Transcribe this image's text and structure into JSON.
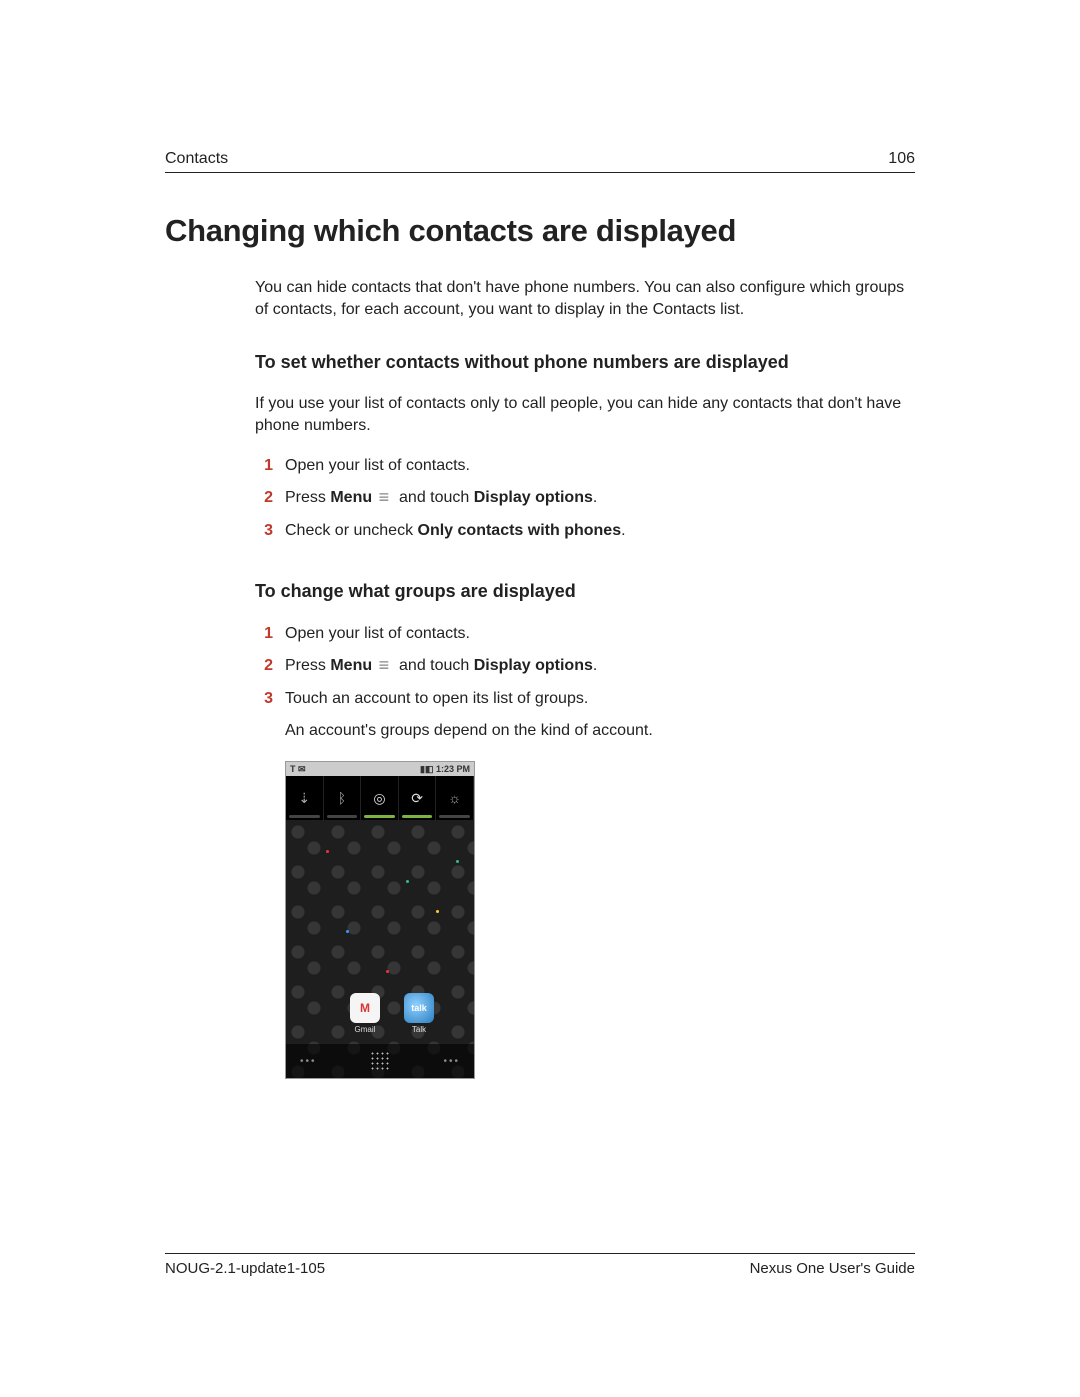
{
  "header": {
    "section": "Contacts",
    "page_number": "106"
  },
  "title": "Changing which contacts are displayed",
  "intro": "You can hide contacts that don't have phone numbers. You can also configure which groups of contacts, for each account, you want to display in the Contacts list.",
  "sections": [
    {
      "heading": "To set whether contacts without phone numbers are displayed",
      "intro": "If you use your list of contacts only to call people, you can hide any contacts that don't have phone numbers.",
      "steps": [
        {
          "n": "1",
          "text_plain": "Open your list of contacts."
        },
        {
          "n": "2",
          "prefix": "Press ",
          "bold1": "Menu",
          "mid": " and touch ",
          "bold2": "Display options",
          "suffix": ".",
          "has_icon": true
        },
        {
          "n": "3",
          "prefix": "Check or uncheck ",
          "bold1": "Only contacts with phones",
          "suffix": "."
        }
      ]
    },
    {
      "heading": "To change what groups are displayed",
      "steps": [
        {
          "n": "1",
          "text_plain": "Open your list of contacts."
        },
        {
          "n": "2",
          "prefix": "Press ",
          "bold1": "Menu",
          "mid": " and touch ",
          "bold2": "Display options",
          "suffix": ".",
          "has_icon": true
        },
        {
          "n": "3",
          "text_plain": "Touch an account to open its list of groups."
        }
      ],
      "note": "An account's groups depend on the kind of account."
    }
  ],
  "phone": {
    "statusbar_left": "T ✉",
    "statusbar_right": "▮◧ 1:23 PM",
    "widgets": [
      {
        "name": "wifi-icon",
        "glyph": "⇣",
        "active": false
      },
      {
        "name": "bluetooth-icon",
        "glyph": "ᛒ",
        "active": false
      },
      {
        "name": "gps-icon",
        "glyph": "◎",
        "active": true
      },
      {
        "name": "sync-icon",
        "glyph": "⟳",
        "active": true
      },
      {
        "name": "brightness-icon",
        "glyph": "☼",
        "active": false
      }
    ],
    "apps": [
      {
        "key": "gmail",
        "label": "Gmail",
        "glyph": "M"
      },
      {
        "key": "talk",
        "label": "Talk",
        "glyph": "talk"
      }
    ]
  },
  "footer": {
    "left": "NOUG-2.1-update1-105",
    "right": "Nexus One User's Guide"
  }
}
